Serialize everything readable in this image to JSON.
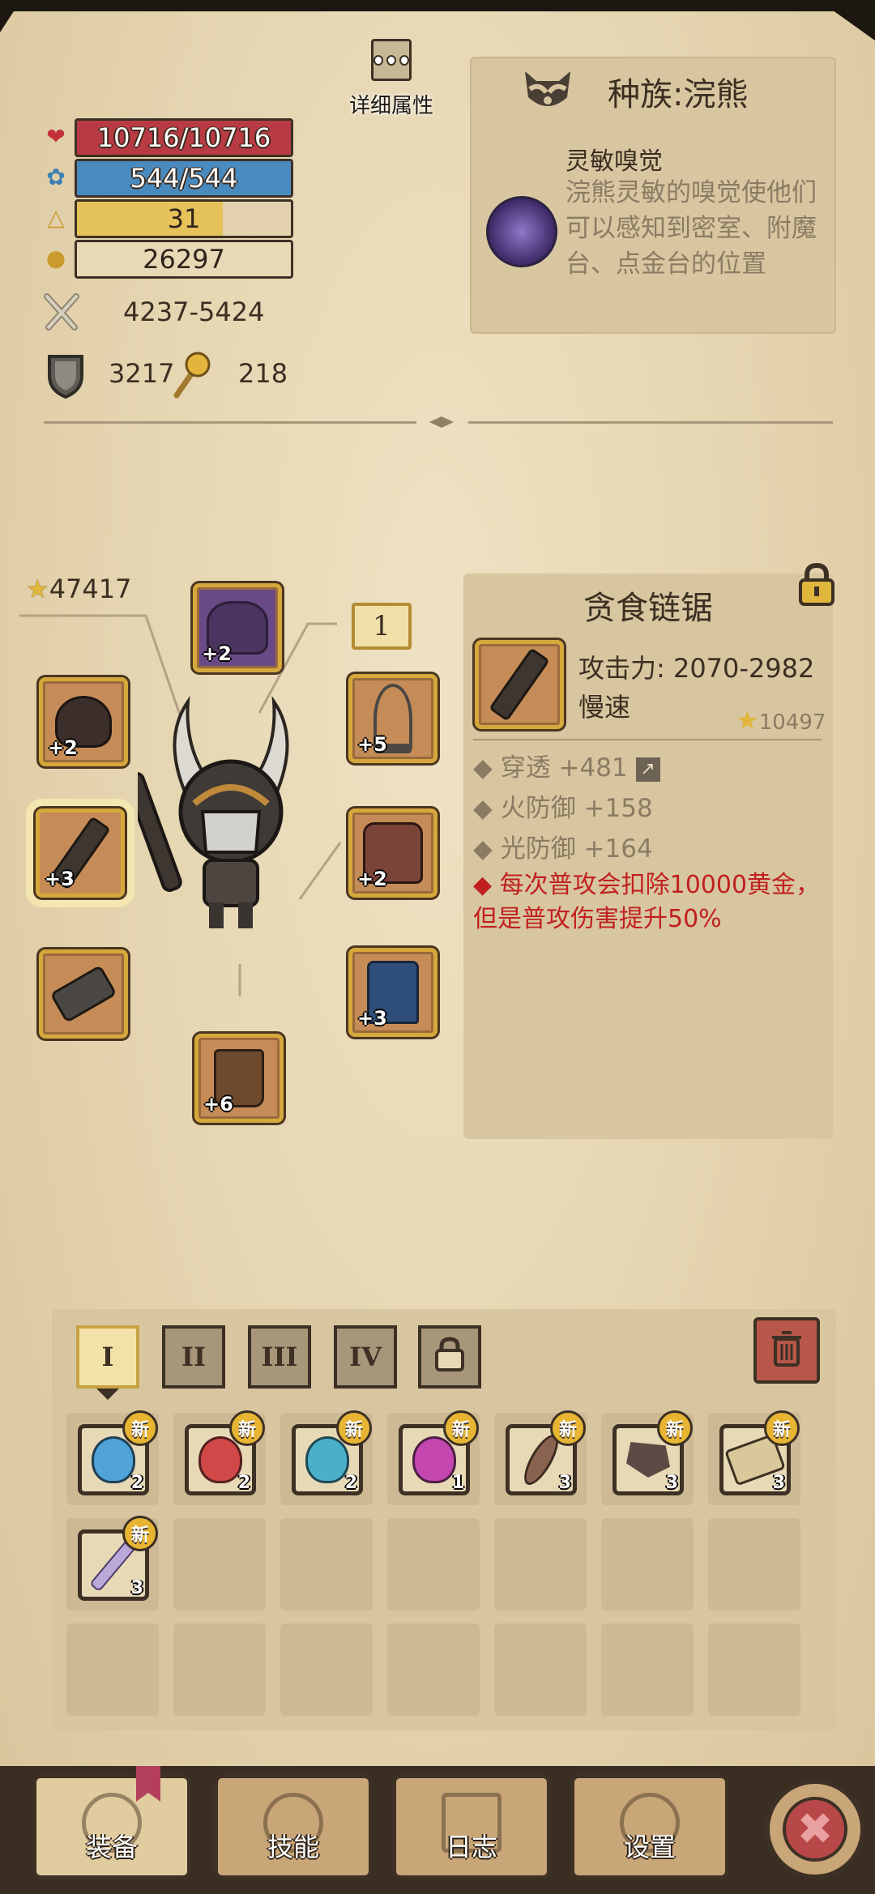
{
  "stats": {
    "hp": "10716/10716",
    "mp": "544/544",
    "level": "31",
    "gold": "26297",
    "attack": "4237-5424",
    "armor": "3217",
    "magic_resist": "218",
    "hp_pct": 1.0,
    "mp_pct": 1.0,
    "level_pct": 0.68
  },
  "details_button": {
    "label": "详细属性",
    "icon": "more-dots-icon"
  },
  "race": {
    "title": "种族:浣熊",
    "trait_name": "灵敏嗅觉",
    "trait_desc": "浣熊灵敏的嗅觉使他们可以感知到密室、附魔台、点金台的位置"
  },
  "equipment": {
    "total_score": "47417",
    "page_label": "1",
    "slots": [
      {
        "name": "helmet",
        "level": "+2"
      },
      {
        "name": "mask",
        "level": "+2"
      },
      {
        "name": "weapon",
        "level": "+3"
      },
      {
        "name": "gauntlet",
        "level": ""
      },
      {
        "name": "boots",
        "level": "+6"
      },
      {
        "name": "necklace",
        "level": "+5"
      },
      {
        "name": "chest-armor",
        "level": "+2"
      },
      {
        "name": "leg-armor",
        "level": "+3"
      }
    ]
  },
  "item": {
    "name": "贪食链锯",
    "attack": "攻击力: 2070-2982",
    "speed": "慢速",
    "score": "10497",
    "stats": [
      {
        "text": "穿透 +481"
      },
      {
        "text": "火防御 +158"
      },
      {
        "text": "光防御 +164"
      }
    ],
    "special": "每次普攻会扣除10000黄金，但是普攻伤害提升50%",
    "colors": {
      "special": "#c0201f",
      "accent": "#d6a83b"
    }
  },
  "bag": {
    "tabs": [
      "I",
      "II",
      "III",
      "IV"
    ],
    "new_label": "新",
    "items": [
      {
        "name": "blue-potion",
        "count": "2",
        "new": true
      },
      {
        "name": "red-potion",
        "count": "2",
        "new": true
      },
      {
        "name": "cyan-potion",
        "count": "2",
        "new": true
      },
      {
        "name": "purple-potion",
        "count": "1",
        "new": true
      },
      {
        "name": "feather",
        "count": "3",
        "new": true
      },
      {
        "name": "gem-shard",
        "count": "3",
        "new": true
      },
      {
        "name": "rune-scroll",
        "count": "3",
        "new": true
      },
      {
        "name": "blade-shard",
        "count": "3",
        "new": true
      }
    ]
  },
  "nav": {
    "equip": "装备",
    "skills": "技能",
    "log": "日志",
    "settings": "设置"
  }
}
